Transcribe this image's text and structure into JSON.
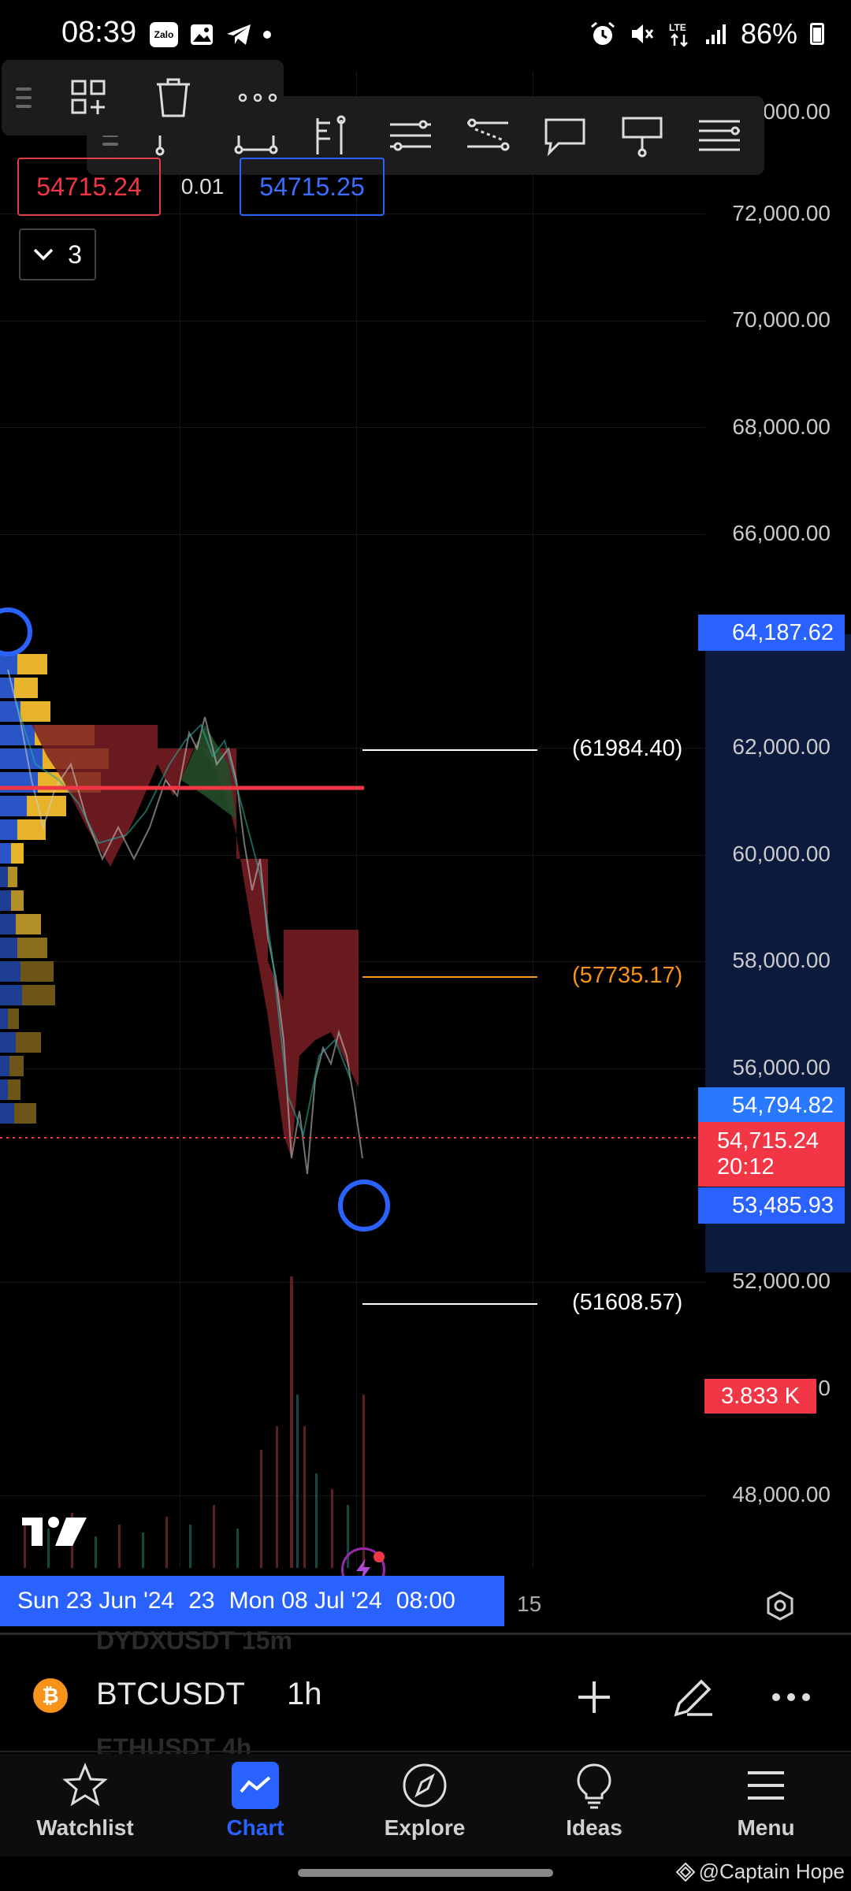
{
  "status_bar": {
    "time": "08:39",
    "zalo_label": "Zalo",
    "battery": "86%",
    "network": "LTE"
  },
  "chart": {
    "symbol": "BTCUSDT",
    "interval": "1h",
    "price_axis": [
      "72,000.00",
      "70,000.00",
      "68,000.00",
      "66,000.00",
      "62,000.00",
      "60,000.00",
      "58,000.00",
      "56,000.00",
      "52,000.00",
      "48,000.00"
    ],
    "axis_top_partial": "000.00",
    "axis_partial_50": "0",
    "badges": {
      "upper_level": "64,187.62",
      "ask": "54,794.82",
      "last_price": "54,715.24",
      "countdown": "20:12",
      "lower_level": "53,485.93",
      "volume": "3.833 K"
    },
    "levels": {
      "upper": "(61984.40)",
      "mid": "(57735.17)",
      "lower": "(51608.57)"
    },
    "order_panel": {
      "sell_price": "54715.24",
      "spread": "0.01",
      "buy_price": "54715.25",
      "collapse_count": "3"
    },
    "date_axis": {
      "labels": [
        "Sun 23 Jun '24",
        "23",
        "Mon 08 Jul '24",
        "08:00"
      ],
      "trailing": "15"
    },
    "colors": {
      "up": "#26a69a",
      "down": "#ef5350",
      "accent": "#2962ff",
      "level_orange": "#f7931a",
      "price_red": "#f23645"
    }
  },
  "toolbar": {
    "small_icons": [
      "drag-grip-icon",
      "add-to-layout-icon",
      "trash-icon",
      "more-icon"
    ],
    "big_icons": [
      "drag-grip-icon",
      "path-tool-icon",
      "rectangle-tool-icon",
      "fib-tool-icon",
      "parallel-channel-icon",
      "regression-icon",
      "callout-icon",
      "signpost-icon",
      "lines-icon"
    ]
  },
  "symbol_bar": {
    "ghost_prev": "DYDXUSDT  15m",
    "ghost_next": "ETHUSDT  4h",
    "coin_glyph": "₿"
  },
  "tabbar": {
    "items": [
      {
        "label": "Watchlist"
      },
      {
        "label": "Chart"
      },
      {
        "label": "Explore"
      },
      {
        "label": "Ideas"
      },
      {
        "label": "Menu"
      }
    ]
  },
  "watermark": "@Captain Hope"
}
